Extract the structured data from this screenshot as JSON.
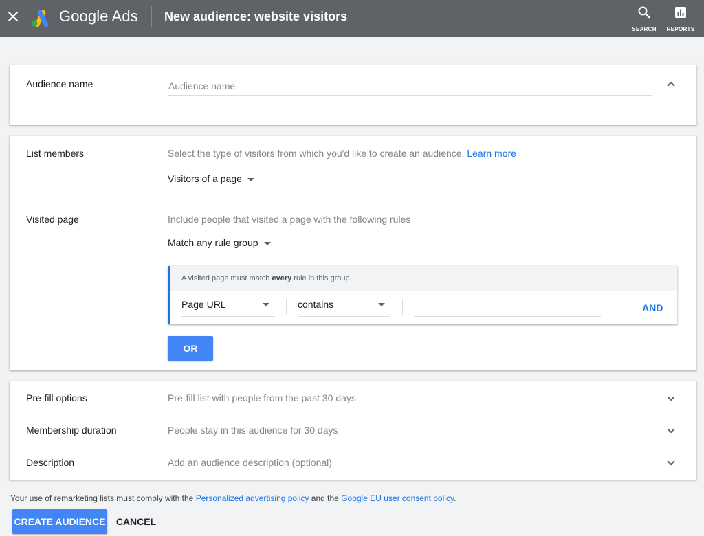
{
  "header": {
    "brand": "Google Ads",
    "title": "New audience: website visitors",
    "actions": [
      {
        "label": "SEARCH",
        "icon": "search-icon"
      },
      {
        "label": "REPORTS",
        "icon": "reports-icon"
      }
    ]
  },
  "audience_name": {
    "label": "Audience name",
    "placeholder": "Audience name",
    "value": ""
  },
  "list_members": {
    "label": "List members",
    "helper": "Select the type of visitors from which you'd like to create an audience.",
    "learn_more": "Learn more",
    "selected": "Visitors of a page"
  },
  "visited_page": {
    "label": "Visited page",
    "helper": "Include people that visited a page with the following rules",
    "match_selected": "Match any rule group",
    "rule_group": {
      "header_prefix": "A visited page must match",
      "header_bold": "every",
      "header_suffix": "rule in this group",
      "field": "Page URL",
      "operator": "contains",
      "value": "",
      "and_label": "AND"
    },
    "or_label": "OR"
  },
  "options": [
    {
      "label": "Pre-fill options",
      "value": "Pre-fill list with people from the past 30 days"
    },
    {
      "label": "Membership duration",
      "value": "People stay in this audience for 30 days"
    },
    {
      "label": "Description",
      "value": "Add an audience description (optional)"
    }
  ],
  "footer": {
    "text_before": "Your use of remarketing lists must comply with the",
    "link1": "Personalized advertising policy",
    "text_middle": "and the",
    "link2": "Google EU user consent policy",
    "text_after": ".",
    "create_label": "CREATE AUDIENCE",
    "cancel_label": "CANCEL"
  },
  "colors": {
    "topbar": "#5f6368",
    "accent": "#1a73e8",
    "button": "#4285f4",
    "background": "#f1f3f4"
  }
}
